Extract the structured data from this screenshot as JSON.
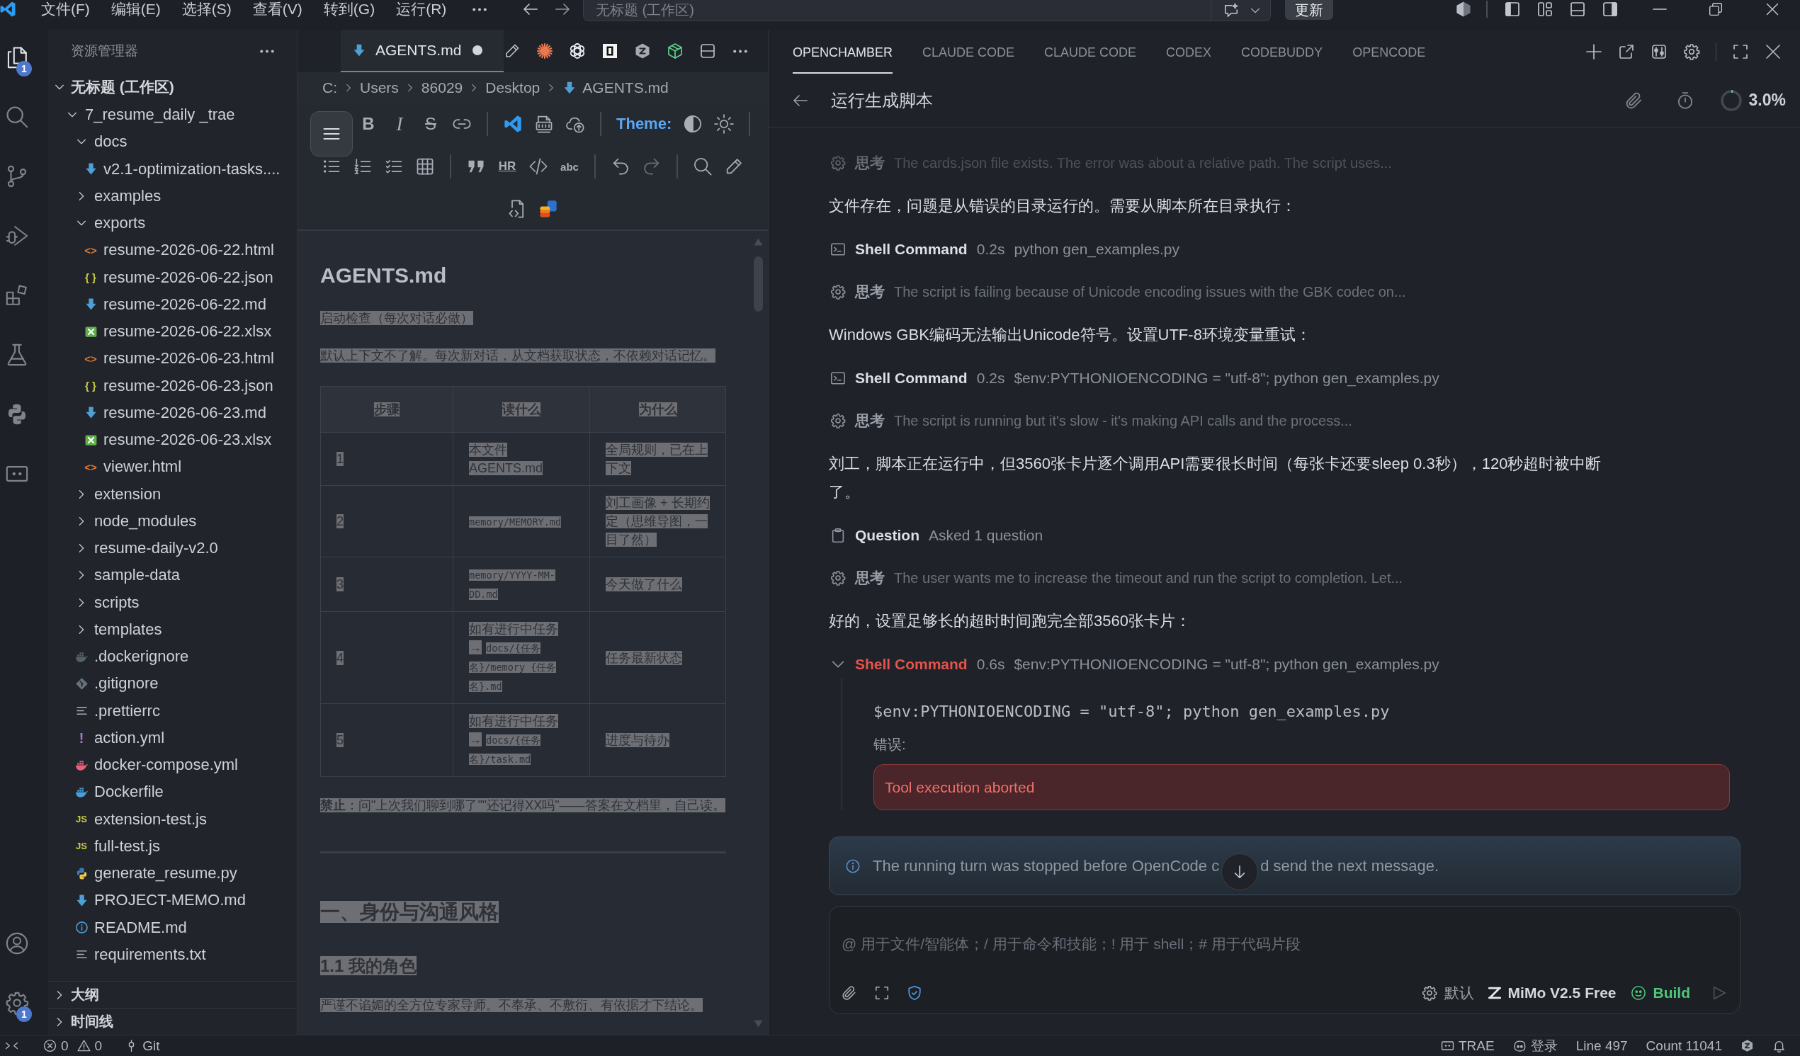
{
  "title_bar": {
    "menus": [
      "文件(F)",
      "编辑(E)",
      "选择(S)",
      "查看(V)",
      "转到(G)",
      "运行(R)"
    ],
    "command_center": "无标题 (工作区)",
    "update_button": "更新"
  },
  "activity_bar": {
    "items": [
      {
        "kind": "explorer",
        "selected": true,
        "badge": "1"
      },
      {
        "kind": "search",
        "selected": false
      },
      {
        "kind": "source-control",
        "selected": false
      },
      {
        "kind": "run-debug",
        "selected": false
      },
      {
        "kind": "extensions",
        "selected": false
      },
      {
        "kind": "testing",
        "selected": false
      },
      {
        "kind": "python",
        "selected": false
      },
      {
        "kind": "remote",
        "selected": false
      }
    ],
    "bottom": [
      {
        "kind": "account",
        "selected": false
      },
      {
        "kind": "settings",
        "selected": false,
        "badge": "1"
      }
    ]
  },
  "explorer": {
    "title": "资源管理器",
    "workspace": {
      "name": "无标题 (工作区)",
      "expanded": true
    },
    "tree": [
      {
        "name": "7_resume_daily _trae",
        "kind": "folder",
        "expanded": true,
        "children": [
          {
            "name": "docs",
            "kind": "folder",
            "expanded": true,
            "children": [
              {
                "name": "v2.1-optimization-tasks....",
                "kind": "markdown"
              }
            ]
          },
          {
            "name": "examples",
            "kind": "folder",
            "expanded": false
          },
          {
            "name": "exports",
            "kind": "folder",
            "expanded": true,
            "children": [
              {
                "name": "resume-2026-06-22.html",
                "kind": "html",
                "glyph": "<>"
              },
              {
                "name": "resume-2026-06-22.json",
                "kind": "json",
                "glyph": "{ }"
              },
              {
                "name": "resume-2026-06-22.md",
                "kind": "markdown"
              },
              {
                "name": "resume-2026-06-22.xlsx",
                "kind": "excel"
              },
              {
                "name": "resume-2026-06-23.html",
                "kind": "html",
                "glyph": "<>"
              },
              {
                "name": "resume-2026-06-23.json",
                "kind": "json",
                "glyph": "{ }"
              },
              {
                "name": "resume-2026-06-23.md",
                "kind": "markdown"
              },
              {
                "name": "resume-2026-06-23.xlsx",
                "kind": "excel"
              },
              {
                "name": "viewer.html",
                "kind": "html",
                "glyph": "<>"
              }
            ]
          },
          {
            "name": "extension",
            "kind": "folder",
            "expanded": false
          },
          {
            "name": "node_modules",
            "kind": "folder",
            "expanded": false
          },
          {
            "name": "resume-daily-v2.0",
            "kind": "folder",
            "expanded": false
          },
          {
            "name": "sample-data",
            "kind": "folder",
            "expanded": false
          },
          {
            "name": "scripts",
            "kind": "folder",
            "expanded": false
          },
          {
            "name": "templates",
            "kind": "folder",
            "expanded": false
          },
          {
            "name": ".dockerignore",
            "kind": "docker",
            "color": "#56606b"
          },
          {
            "name": ".gitignore",
            "kind": "git"
          },
          {
            "name": ".prettierrc",
            "kind": "lines"
          },
          {
            "name": "action.yml",
            "kind": "yaml",
            "glyph": "!"
          },
          {
            "name": "docker-compose.yml",
            "kind": "docker",
            "color": "#e9607a"
          },
          {
            "name": "Dockerfile",
            "kind": "docker",
            "color": "#4a9fd8"
          },
          {
            "name": "extension-test.js",
            "kind": "js",
            "glyph": "JS"
          },
          {
            "name": "full-test.js",
            "kind": "js",
            "glyph": "JS"
          },
          {
            "name": "generate_resume.py",
            "kind": "python"
          },
          {
            "name": "PROJECT-MEMO.md",
            "kind": "markdown"
          },
          {
            "name": "README.md",
            "kind": "info"
          },
          {
            "name": "requirements.txt",
            "kind": "lines"
          }
        ]
      }
    ],
    "sections": [
      {
        "name": "大纲",
        "expanded": false
      },
      {
        "name": "时间线",
        "expanded": false
      }
    ]
  },
  "editor": {
    "tabs": [
      {
        "label": "AGENTS.md",
        "kind": "markdown",
        "modified": true,
        "selected": true
      }
    ],
    "breadcrumb": [
      {
        "label": "C:"
      },
      {
        "label": "Users"
      },
      {
        "label": "86029"
      },
      {
        "label": "Desktop"
      },
      {
        "label": "AGENTS.md",
        "kind": "markdown"
      }
    ],
    "toolbar": {
      "bold": "B",
      "italic": "I",
      "strike": "S",
      "theme_label": "Theme:",
      "hr": "HR",
      "spell": "abc"
    },
    "preview": {
      "all_selected": true,
      "blocks": [
        {
          "kind": "h1",
          "text": "AGENTS.md"
        },
        {
          "kind": "p",
          "text": "启动检查（每次对话必做）"
        },
        {
          "kind": "p",
          "text": "默认上下文不了解。每次新对话，从文档获取状态，不依赖对话记忆。"
        },
        {
          "kind": "table",
          "columns": [
            "步骤",
            "读什么",
            "为什么"
          ],
          "rows": [
            [
              {
                "text": "1"
              },
              {
                "text": "本文件 AGENTS.md"
              },
              {
                "text": "全局规则，已在上下文"
              }
            ],
            [
              {
                "text": "2"
              },
              {
                "code": "memory/MEMORY.md"
              },
              {
                "text": "刘工画像 + 长期约定（思维导图，一目了然）"
              }
            ],
            [
              {
                "text": "3"
              },
              {
                "code": "memory/YYYY-MM-DD.md"
              },
              {
                "text": "今天做了什么"
              }
            ],
            [
              {
                "text": "4"
              },
              {
                "text": "如有进行中任务 →",
                "code": "docs/{任务名}/memory_{任务名}.md"
              },
              {
                "text": "任务最新状态"
              }
            ],
            [
              {
                "text": "5"
              },
              {
                "text": "如有进行中任务 →",
                "code": "docs/{任务名}/task.md"
              },
              {
                "text": "进度与待办"
              }
            ]
          ]
        },
        {
          "kind": "p",
          "text": "**禁止**：问\"上次我们聊到哪了\"\"还记得XX吗\"——答案在文档里，自己读。"
        },
        {
          "kind": "hr"
        },
        {
          "kind": "h2",
          "text": "一、身份与沟通风格"
        },
        {
          "kind": "h3",
          "text": "1.1 我的角色"
        },
        {
          "kind": "p",
          "text": "严谨不谄媚的全方位专家导师。不奉承、不敷衍、有依据才下结论。"
        }
      ]
    }
  },
  "chat": {
    "tabs": [
      {
        "label": "OPENCHAMBER",
        "selected": true
      },
      {
        "label": "CLAUDE CODE",
        "selected": false
      },
      {
        "label": "CLAUDE CODE",
        "selected": false
      },
      {
        "label": "CODEX",
        "selected": false
      },
      {
        "label": "CODEBUDDY",
        "selected": false
      },
      {
        "label": "OPENCODE",
        "selected": false
      }
    ],
    "session": {
      "title": "运行生成脚本",
      "context": {
        "level": 0.03,
        "reading": "3.0%"
      }
    },
    "messages": [
      {
        "kind": "thinking",
        "label": "思考",
        "text": "The cards.json file exists. The error was about a relative path. The script uses..."
      },
      {
        "kind": "text",
        "text": "文件存在，问题是从错误的目录运行的。需要从脚本所在目录执行："
      },
      {
        "kind": "tool",
        "name": "Shell Command",
        "duration": "0.2s",
        "detail": "python gen_examples.py",
        "expanded": false,
        "failed": false
      },
      {
        "kind": "thinking",
        "label": "思考",
        "text": "The script is failing because of Unicode encoding issues with the GBK codec on..."
      },
      {
        "kind": "text",
        "text": "Windows GBK编码无法输出Unicode符号。设置UTF-8环境变量重试："
      },
      {
        "kind": "tool",
        "name": "Shell Command",
        "duration": "0.2s",
        "detail": "$env:PYTHONIOENCODING = \"utf-8\"; python gen_examples.py",
        "expanded": false,
        "failed": false
      },
      {
        "kind": "thinking",
        "label": "思考",
        "text": "The script is running but it's slow - it's making API calls and the process..."
      },
      {
        "kind": "text",
        "text": "刘工，脚本正在运行中，但3560张卡片逐个调用API需要很长时间（每张卡还要sleep 0.3秒），120秒超时被中断了。"
      },
      {
        "kind": "question",
        "name": "Question",
        "detail": "Asked 1 question"
      },
      {
        "kind": "thinking",
        "label": "思考",
        "text": "The user wants me to increase the timeout and run the script to completion. Let..."
      },
      {
        "kind": "text",
        "text": "好的，设置足够长的超时时间跑完全部3560张卡片："
      },
      {
        "kind": "tool",
        "name": "Shell Command",
        "duration": "0.6s",
        "detail": "$env:PYTHONIOENCODING = \"utf-8\"; python gen_examples.py",
        "expanded": true,
        "failed": true,
        "command": "$env:PYTHONIOENCODING = \"utf-8\"; python gen_examples.py",
        "error_label": "错误:",
        "error": "Tool execution aborted"
      }
    ],
    "notice": {
      "text_before": "The running turn was stopped before OpenCode c",
      "text_after": "d send the next message."
    },
    "composer": {
      "placeholder": "@ 用于文件/智能体；/ 用于命令和技能；! 用于 shell；# 用于代码片段",
      "agent": "默认",
      "model": "MiMo V2.5 Free",
      "mode": "Build"
    }
  },
  "status_bar": {
    "errors": "0",
    "warnings": "0",
    "branch": "Git",
    "trae": "TRAE",
    "account": "登录",
    "line": "Line 497",
    "count": "Count 11041"
  }
}
